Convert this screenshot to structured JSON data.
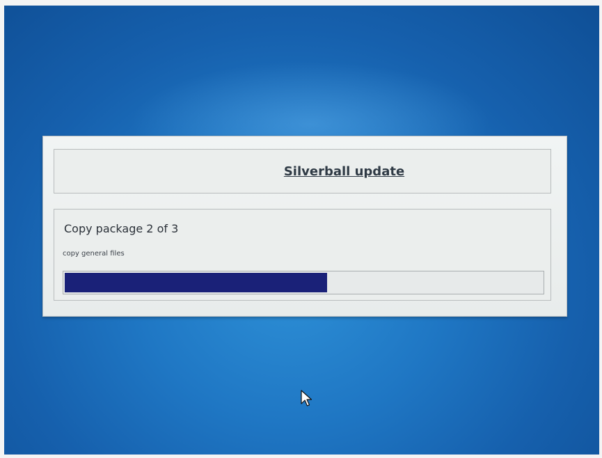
{
  "dialog": {
    "title": "Silverball update",
    "package_text": "Copy package 2 of 3",
    "step_text": "copy general files",
    "progress_fraction": 0.55
  },
  "colors": {
    "desktop_background": "#1f77c4",
    "dialog_background": "#ebeeed",
    "progress_fill": "#1a2178"
  },
  "icons": {
    "cursor": "mouse-pointer-icon"
  }
}
